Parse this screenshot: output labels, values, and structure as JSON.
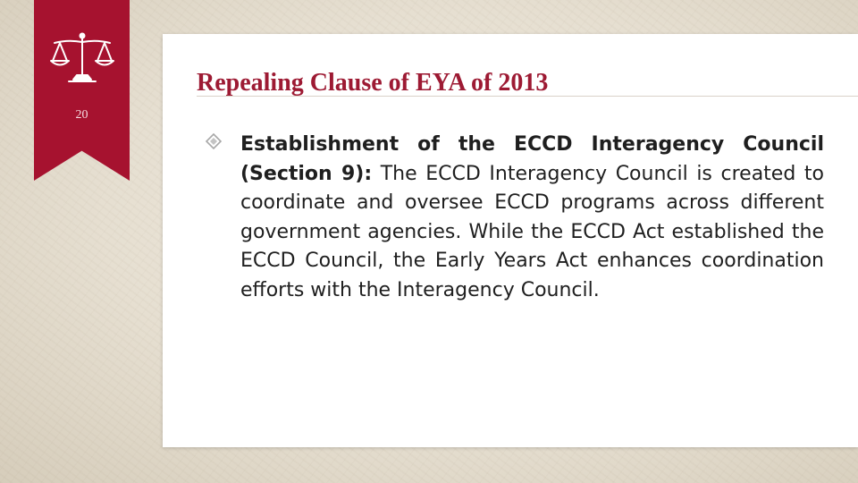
{
  "slide": {
    "number": "20",
    "title": "Repealing Clause of EYA of 2013"
  },
  "icons": {
    "badge_icon": "scales-of-justice-icon",
    "bullet_icon": "diamond-bullet-icon"
  },
  "bullets": [
    {
      "lead": "Establishment of the ECCD Interagency Council (Section 9):",
      "text": " The ECCD Interagency Council is created to coordinate and oversee ECCD programs across different government agencies. While the ECCD Act established the ECCD Council, the Early Years Act enhances coordination efforts with the Interagency Council."
    }
  ],
  "colors": {
    "accent": "#a6122f",
    "title": "#9d1a33",
    "body_text": "#1f1f1f",
    "bullet": "#a8a8a8",
    "background": "#e6dfd1",
    "card": "#ffffff"
  }
}
